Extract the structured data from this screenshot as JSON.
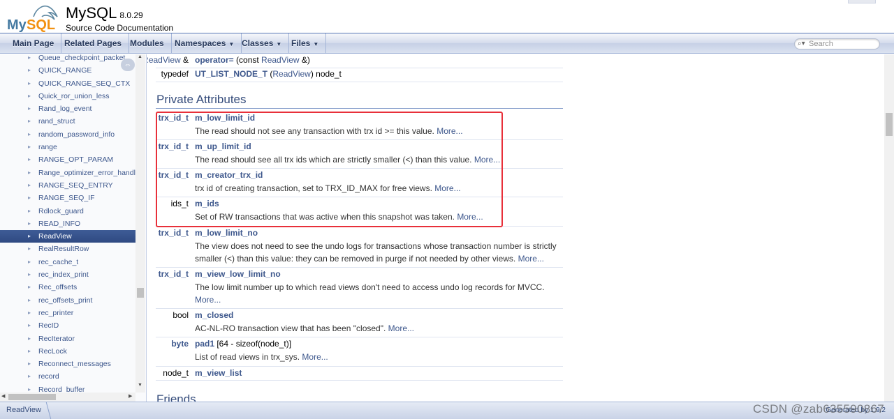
{
  "header": {
    "project_name": "MySQL",
    "project_number": "8.0.29",
    "project_brief": "Source Code Documentation",
    "logo_text_my": "My",
    "logo_text_sql": "SQL"
  },
  "nav": {
    "tabs": [
      {
        "label": "Main Page",
        "has_caret": false
      },
      {
        "label": "Related Pages",
        "has_caret": false
      },
      {
        "label": "Modules",
        "has_caret": false
      },
      {
        "label": "Namespaces",
        "has_caret": true
      },
      {
        "label": "Classes",
        "has_caret": true
      },
      {
        "label": "Files",
        "has_caret": true
      }
    ],
    "search_placeholder": "Search"
  },
  "sidebar": {
    "items": [
      "Queue_checkpoint_packet",
      "QUICK_RANGE",
      "QUICK_RANGE_SEQ_CTX",
      "Quick_ror_union_less",
      "Rand_log_event",
      "rand_struct",
      "random_password_info",
      "range",
      "RANGE_OPT_PARAM",
      "Range_optimizer_error_handler",
      "RANGE_SEQ_ENTRY",
      "RANGE_SEQ_IF",
      "Rdlock_guard",
      "READ_INFO",
      "ReadView",
      "RealResultRow",
      "rec_cache_t",
      "rec_index_print",
      "Rec_offsets",
      "rec_offsets_print",
      "rec_printer",
      "RecID",
      "RecIterator",
      "RecLock",
      "Reconnect_messages",
      "record",
      "Record_buffer"
    ],
    "selected": "ReadView",
    "sync_icon": "sync-arrows-icon"
  },
  "content": {
    "top_rows": [
      {
        "left_type": "ReadView",
        "left_suffix": " &",
        "name": "operator=",
        "args_pre": " (const ",
        "args_type": "ReadView",
        "args_post": " &)"
      },
      {
        "left_type": "",
        "left_plain": "typedef",
        "name": "UT_LIST_NODE_T",
        "args_pre": " (",
        "args_type": "ReadView",
        "args_post": ") node_t"
      }
    ],
    "section_private": "Private Attributes",
    "attributes": [
      {
        "type": "trx_id_t",
        "type_link": true,
        "name": "m_low_limit_id",
        "extra": "",
        "desc": "The read should not see any transaction with trx id >= this value.",
        "more": "More..."
      },
      {
        "type": "trx_id_t",
        "type_link": true,
        "name": "m_up_limit_id",
        "extra": "",
        "desc": "The read should see all trx ids which are strictly smaller (<) than this value.",
        "more": "More..."
      },
      {
        "type": "trx_id_t",
        "type_link": true,
        "name": "m_creator_trx_id",
        "extra": "",
        "desc": "trx id of creating transaction, set to TRX_ID_MAX for free views.",
        "more": "More..."
      },
      {
        "type": "ids_t",
        "type_link": false,
        "name": "m_ids",
        "extra": "",
        "desc": "Set of RW transactions that was active when this snapshot was taken.",
        "more": "More..."
      },
      {
        "type": "trx_id_t",
        "type_link": true,
        "name": "m_low_limit_no",
        "extra": "",
        "desc": "The view does not need to see the undo logs for transactions whose transaction number is strictly smaller (<) than this value: they can be removed in purge if not needed by other views.",
        "more": "More..."
      },
      {
        "type": "trx_id_t",
        "type_link": true,
        "name": "m_view_low_limit_no",
        "extra": "",
        "desc": "The low limit number up to which read views don't need to access undo log records for MVCC.",
        "more": "More..."
      },
      {
        "type": "bool",
        "type_link": false,
        "name": "m_closed",
        "extra": "",
        "desc": "AC-NL-RO transaction view that has been \"closed\".",
        "more": "More..."
      },
      {
        "type": "byte",
        "type_link": true,
        "name": "pad1",
        "extra": " [64 - sizeof(node_t)]",
        "desc": "List of read views in trx_sys.",
        "more": "More..."
      },
      {
        "type": "node_t",
        "type_link": false,
        "name": "m_view_list",
        "extra": "",
        "desc": "",
        "more": ""
      }
    ],
    "section_friends": "Friends"
  },
  "footer": {
    "breadcrumb": "ReadView",
    "generated": "Generated by",
    "version_frag": "1.9.2",
    "watermark": "CSDN @zab635590867"
  },
  "colors": {
    "highlight_box": "#e8303a",
    "link": "#3d578c",
    "selected_bg": "#34528c"
  }
}
